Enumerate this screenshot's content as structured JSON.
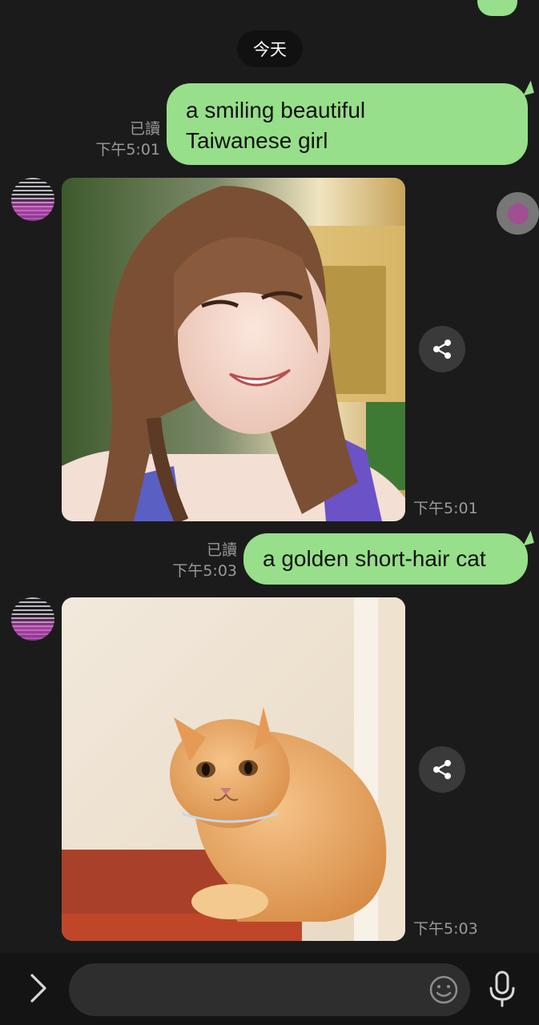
{
  "date_separator": "今天",
  "messages": [
    {
      "type": "sent_text",
      "text_lines": [
        "a smiling beautiful",
        "Taiwanese girl"
      ],
      "read_label": "已讀",
      "time": "下午5:01"
    },
    {
      "type": "received_image",
      "image_desc": "portrait of smiling young woman with brown hair",
      "time": "下午5:01"
    },
    {
      "type": "sent_text",
      "text_lines": [
        "a golden short-hair cat"
      ],
      "read_label": "已讀",
      "time": "下午5:03"
    },
    {
      "type": "received_image",
      "image_desc": "orange short-hair cat sitting",
      "time": "下午5:03"
    }
  ],
  "input": {
    "placeholder": "",
    "value": ""
  },
  "icons": {
    "expand": "chevron-right-icon",
    "emoji": "emoji-icon",
    "mic": "microphone-icon",
    "share": "share-icon"
  },
  "colors": {
    "background": "#1b1b1b",
    "sent_bubble": "#97df8a",
    "meta_text": "#9a9a9a",
    "input_bg": "#2e2e2e"
  }
}
